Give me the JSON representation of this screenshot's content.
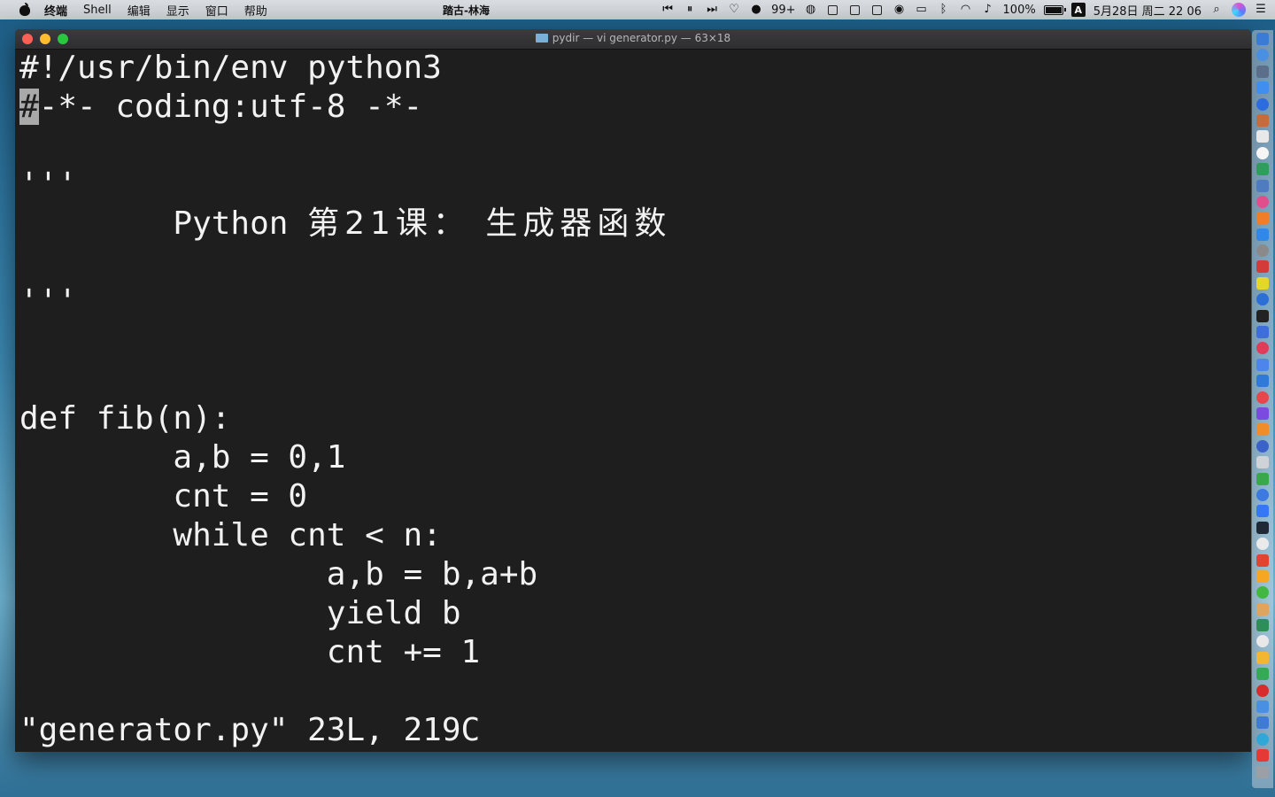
{
  "menubar": {
    "items": [
      "终端",
      "Shell",
      "编辑",
      "显示",
      "窗口",
      "帮助"
    ],
    "center_title": "踏古-林海",
    "tray": {
      "notification_count": "99+",
      "battery": "100%",
      "input_method": "A",
      "datetime": "5月28日 周二  22 06"
    }
  },
  "window": {
    "title": "pydir — vi generator.py — 63×18",
    "lines": [
      "#!/usr/bin/env python3",
      "#",
      "-*- coding:utf-8 -*-",
      "",
      "'''",
      "        Python ",
      "第21课： 生成器函数",
      "",
      "'''",
      "",
      "",
      "def fib(n):",
      "        a,b = 0,1",
      "        cnt = 0",
      "        while cnt < n:",
      "                a,b = b,a+b",
      "                yield b",
      "                cnt += 1",
      "",
      "\"generator.py\" 23L, 219C"
    ]
  },
  "dock": {
    "icon_colors": [
      "#3a7bd5",
      "#4a90e2",
      "#5b6f8a",
      "#3f8ef0",
      "#2d6cdf",
      "#c46d3b",
      "#e8e8e8",
      "#f5f5f5",
      "#2f9e5c",
      "#4f7cc0",
      "#e04f8c",
      "#ef7d2a",
      "#2f89e8",
      "#8a8a8a",
      "#d33a3a",
      "#e5d62a",
      "#2b6fd6",
      "#222222",
      "#3d6edb",
      "#e23b5a",
      "#4c86ec",
      "#2f7ad9",
      "#e8464c",
      "#7b4be0",
      "#f08c2a",
      "#3a62c9",
      "#cfd3d8",
      "#39a84a",
      "#3c79e0",
      "#3478f6",
      "#1f2a36",
      "#eaeaea",
      "#e3442f",
      "#f5a623",
      "#42b842",
      "#e0a45c",
      "#2c8f57",
      "#e8e8e8",
      "#f2b632",
      "#33aa55",
      "#d82c2c",
      "#4a90e2",
      "#3f7ad6",
      "#2fa8d8",
      "#e53935",
      "#9aa0a6"
    ]
  }
}
